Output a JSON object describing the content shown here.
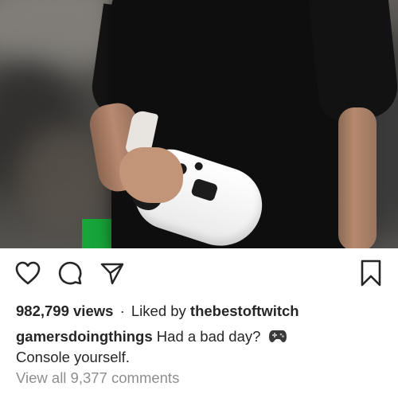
{
  "post": {
    "media": {
      "description_icon": "photo",
      "accent_green": "#18a53a"
    },
    "actions": {
      "like_icon": "heart-icon",
      "comment_icon": "comment-bubble-icon",
      "share_icon": "paper-plane-icon",
      "save_icon": "bookmark-icon"
    },
    "stats": {
      "views": "982,799 views",
      "separator": "·",
      "liked_prefix": "Liked by",
      "liked_user": "thebestoftwitch"
    },
    "caption": {
      "username": "gamersdoingthings",
      "line1": "Had a bad day?",
      "emoji_icon": "game-controller-icon",
      "line2": "Console yourself."
    },
    "comments": {
      "link": "View all 9,377 comments"
    }
  }
}
